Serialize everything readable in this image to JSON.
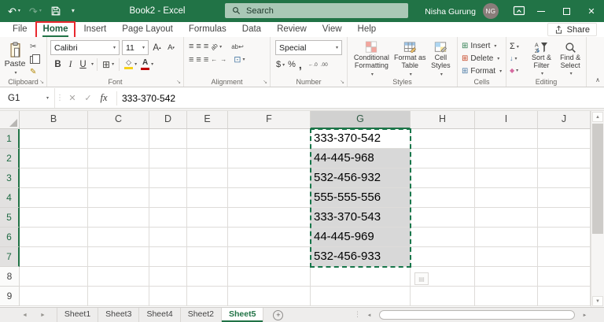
{
  "colors": {
    "excel-green": "#217346",
    "annotation-red": "#e8282e",
    "selection-fill": "#d8d8d8"
  },
  "titlebar": {
    "title": "Book2 - Excel",
    "search_placeholder": "Search",
    "user_name": "Nisha Gurung",
    "user_initials": "NG"
  },
  "tabs": {
    "items": [
      "File",
      "Home",
      "Insert",
      "Page Layout",
      "Formulas",
      "Data",
      "Review",
      "View",
      "Help"
    ],
    "active": "Home",
    "annotated": "Home",
    "share_label": "Share"
  },
  "ribbon": {
    "clipboard": {
      "label": "Clipboard",
      "paste_label": "Paste"
    },
    "font": {
      "label": "Font",
      "name": "Calibri",
      "size": "11",
      "bold": "B",
      "italic": "I",
      "underline": "U",
      "grow": "A",
      "shrink": "A",
      "color_letter": "A"
    },
    "alignment": {
      "label": "Alignment",
      "orientation_text": "ab",
      "wrap_text": "ab"
    },
    "number": {
      "label": "Number",
      "format": "Special",
      "currency": "$",
      "percent": "%",
      "comma": ",",
      "inc_decimal": "←.0",
      "dec_decimal": ".00"
    },
    "styles": {
      "label": "Styles",
      "items": [
        "Conditional Formatting",
        "Format as Table",
        "Cell Styles"
      ]
    },
    "cells": {
      "label": "Cells",
      "items": [
        "Insert",
        "Delete",
        "Format"
      ]
    },
    "editing": {
      "label": "Editing",
      "autosum": "Σ",
      "items": [
        "Sort & Filter",
        "Find & Select"
      ]
    }
  },
  "formula_bar": {
    "name_box": "G1",
    "fx_label": "fx",
    "formula": "333-370-542"
  },
  "grid": {
    "columns": [
      {
        "letter": "B",
        "width": 87
      },
      {
        "letter": "C",
        "width": 78
      },
      {
        "letter": "D",
        "width": 48
      },
      {
        "letter": "E",
        "width": 52
      },
      {
        "letter": "F",
        "width": 105
      },
      {
        "letter": "G",
        "width": 127
      },
      {
        "letter": "H",
        "width": 82
      },
      {
        "letter": "I",
        "width": 80
      },
      {
        "letter": "J",
        "width": 67
      }
    ],
    "row_count": 9,
    "selected_column": "G",
    "selected_rows": [
      1,
      2,
      3,
      4,
      5,
      6,
      7
    ],
    "active_cell": "G1",
    "cells": {
      "G1": "333-370-542",
      "G2": "44-445-968",
      "G3": "532-456-932",
      "G4": "555-555-556",
      "G5": "333-370-543",
      "G6": "44-445-969",
      "G7": "532-456-933"
    }
  },
  "sheet_bar": {
    "tabs": [
      {
        "name": "Sheet1",
        "active": false
      },
      {
        "name": "Sheet3",
        "active": false
      },
      {
        "name": "Sheet4",
        "active": false
      },
      {
        "name": "Sheet2",
        "active": false
      },
      {
        "name": "Sheet5",
        "active": true
      }
    ],
    "add_label": "+"
  }
}
